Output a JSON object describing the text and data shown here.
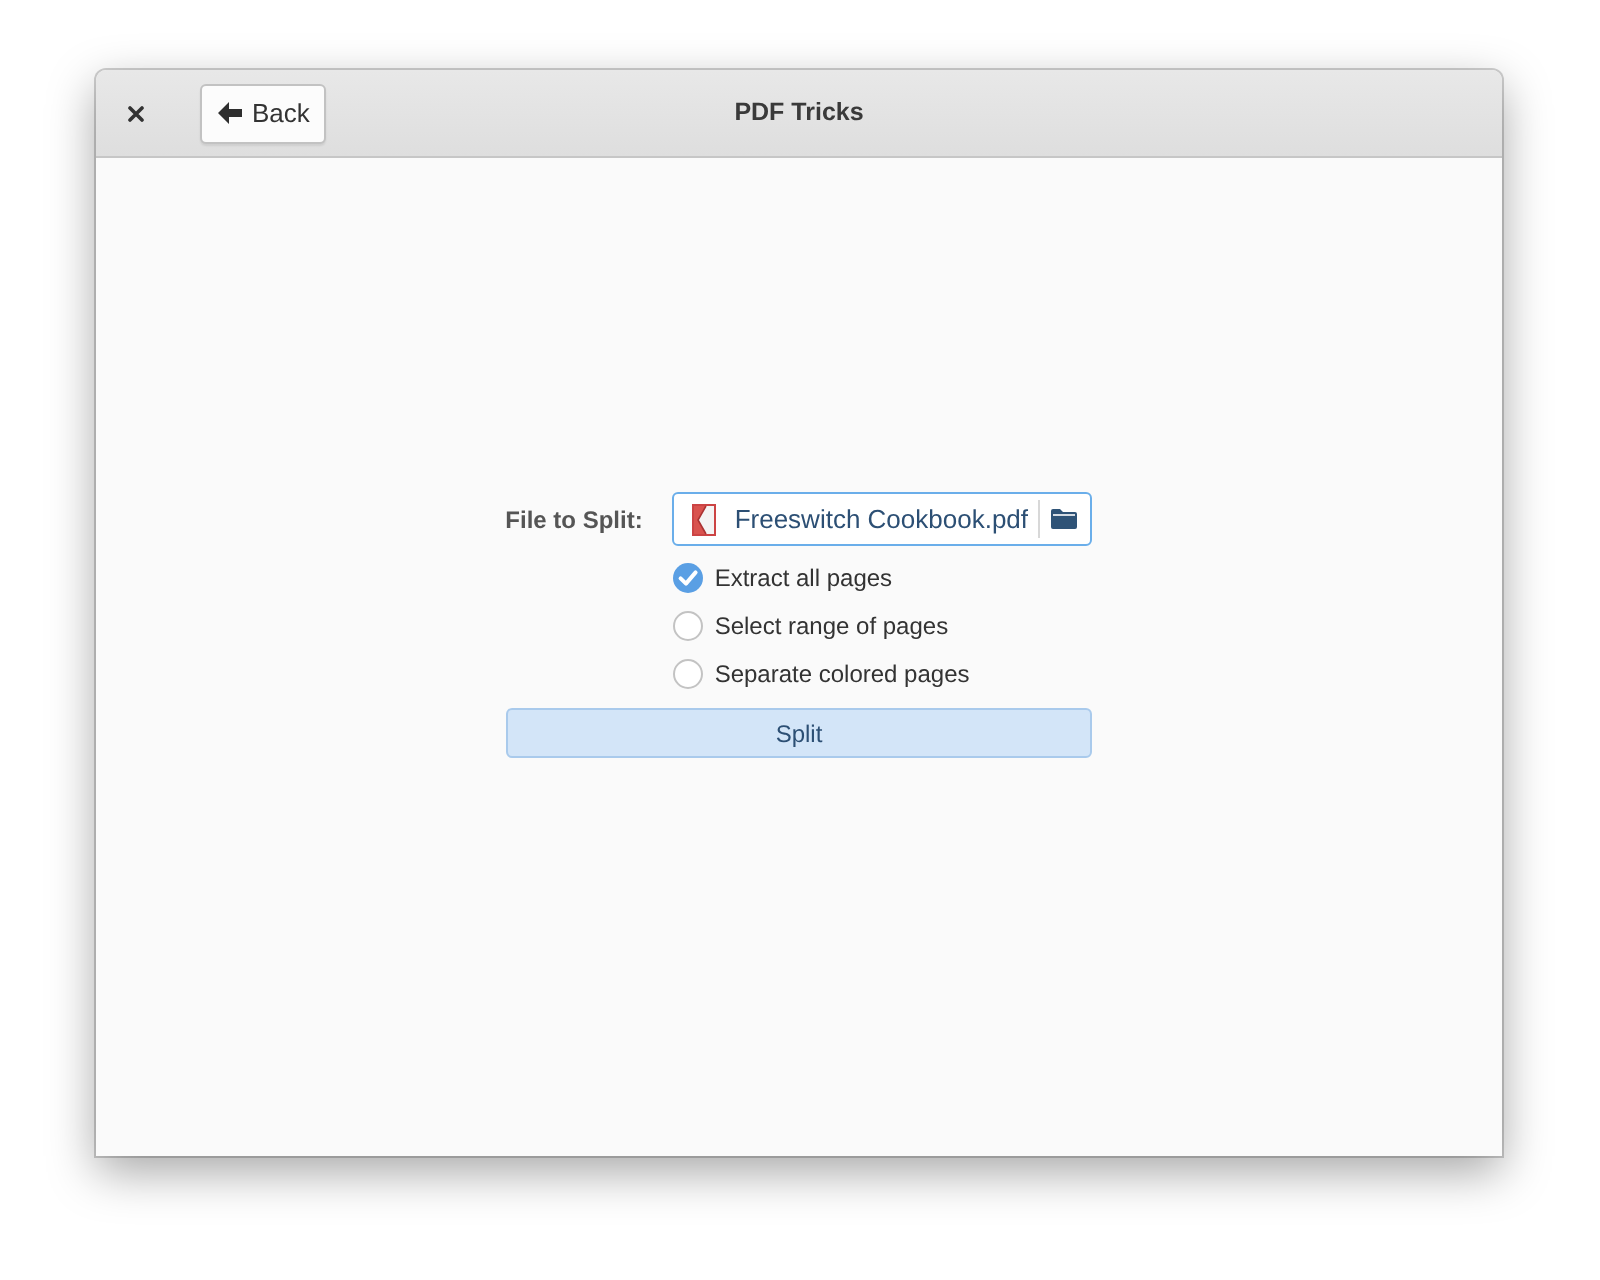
{
  "window": {
    "title": "PDF Tricks"
  },
  "header": {
    "back_button": {
      "label": "Back"
    }
  },
  "form": {
    "file_label": "File to Split:",
    "file_chooser": {
      "filename": "Freeswitch Cookbook.pdf"
    },
    "options": [
      {
        "label": "Extract all pages",
        "selected": true
      },
      {
        "label": "Select range of pages",
        "selected": false
      },
      {
        "label": "Separate colored pages",
        "selected": false
      }
    ],
    "split_button": {
      "label": "Split"
    }
  }
}
